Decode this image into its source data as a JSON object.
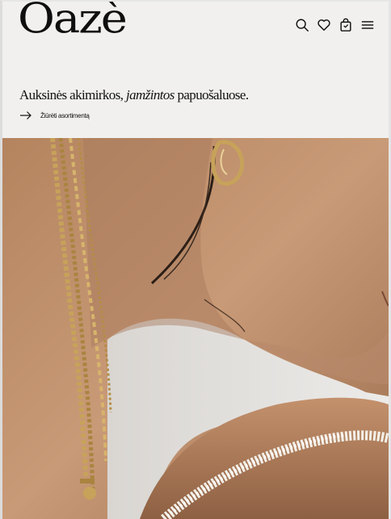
{
  "header": {
    "logo_text": "Oazè",
    "icons": [
      "search-icon",
      "heart-icon",
      "cart-icon",
      "menu-icon"
    ]
  },
  "hero": {
    "tagline_start": "Auksinės akimirkos, ",
    "tagline_emphasis": "jamžintos",
    "tagline_end": " papuošaluose.",
    "cta_label": "Žiūrėti asortimentą"
  },
  "colors": {
    "background": "#f1f0ef",
    "text": "#111111",
    "skin": "#c29373",
    "gold": "#c7a25a"
  }
}
